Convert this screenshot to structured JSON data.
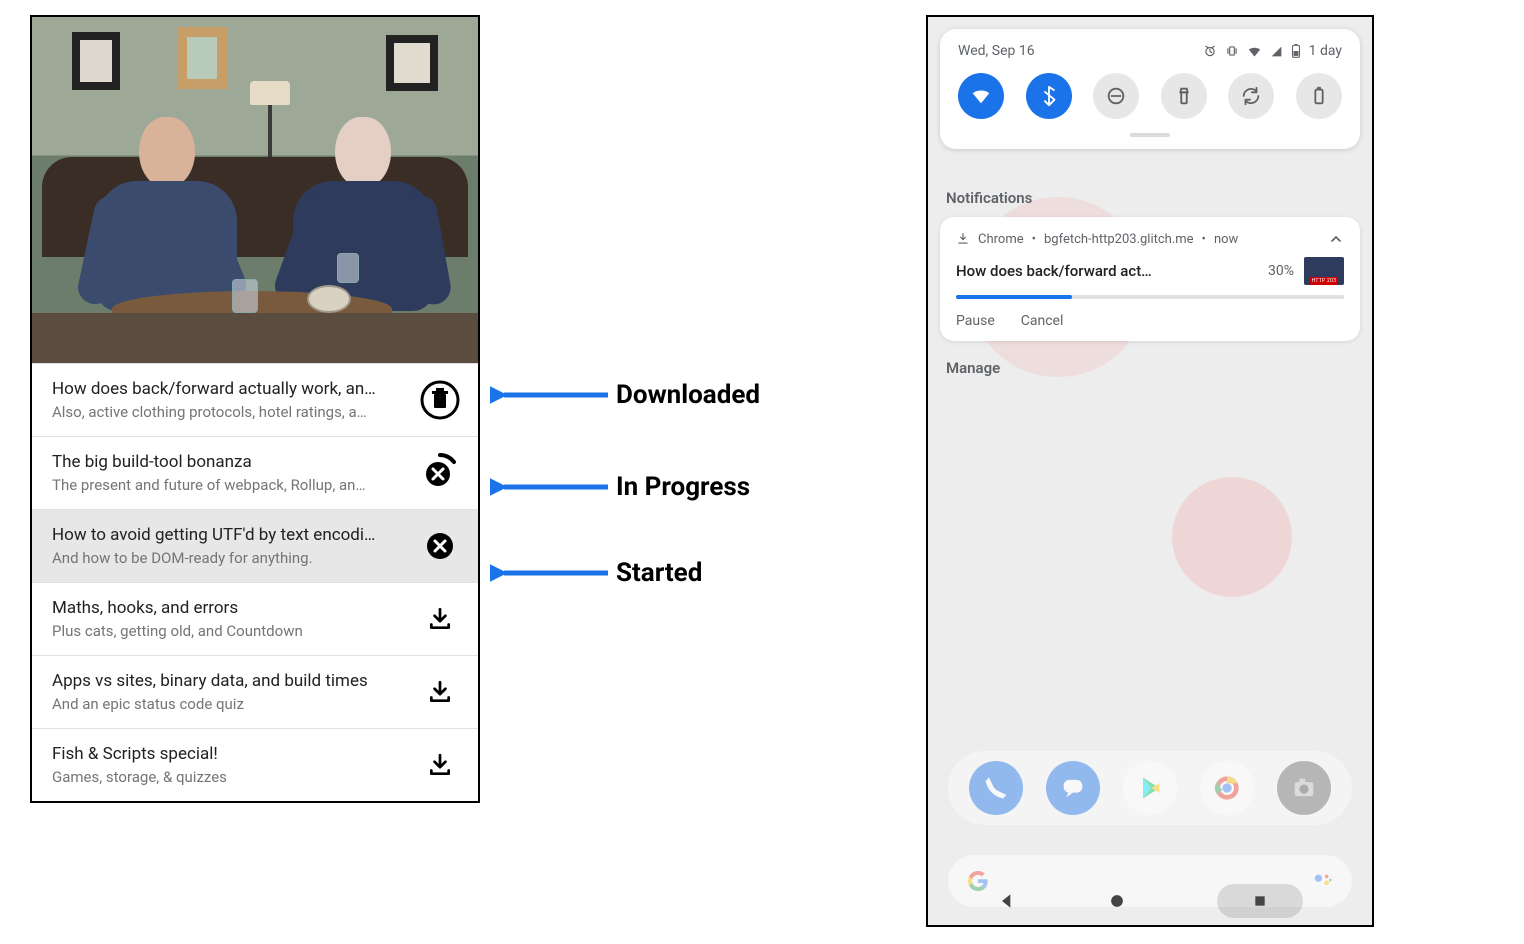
{
  "annotations": {
    "downloaded": "Downloaded",
    "in_progress": "In Progress",
    "started": "Started"
  },
  "videos": [
    {
      "title": "How does back/forward actually work, an…",
      "subtitle": "Also, active clothing protocols, hotel ratings, a…",
      "state": "downloaded",
      "selected": false
    },
    {
      "title": "The big build-tool bonanza",
      "subtitle": "The present and future of webpack, Rollup, an…",
      "state": "in_progress",
      "selected": false
    },
    {
      "title": "How to avoid getting UTF'd by text encodi…",
      "subtitle": "And how to be DOM-ready for anything.",
      "state": "started",
      "selected": true
    },
    {
      "title": "Maths, hooks, and errors",
      "subtitle": "Plus cats, getting old, and Countdown",
      "state": "available",
      "selected": false
    },
    {
      "title": "Apps vs sites, binary data, and build times",
      "subtitle": "And an epic status code quiz",
      "state": "available",
      "selected": false
    },
    {
      "title": "Fish & Scripts special!",
      "subtitle": "Games, storage, & quizzes",
      "state": "available",
      "selected": false
    }
  ],
  "android": {
    "date": "Wed, Sep 16",
    "battery_label": "1 day",
    "section_notifications": "Notifications",
    "section_manage": "Manage",
    "quick_tiles": [
      {
        "name": "wifi",
        "on": true
      },
      {
        "name": "bluetooth",
        "on": true
      },
      {
        "name": "dnd",
        "on": false
      },
      {
        "name": "flashlight",
        "on": false
      },
      {
        "name": "rotate",
        "on": false
      },
      {
        "name": "battery",
        "on": false
      }
    ],
    "notification": {
      "app": "Chrome",
      "source": "bgfetch-http203.glitch.me",
      "time": "now",
      "title": "How does back/forward act…",
      "percent_text": "30%",
      "percent_value": 30,
      "thumb_badge": "HTTP 203",
      "action_pause": "Pause",
      "action_cancel": "Cancel"
    },
    "dock": [
      "phone",
      "messages",
      "play",
      "chrome",
      "camera"
    ]
  }
}
